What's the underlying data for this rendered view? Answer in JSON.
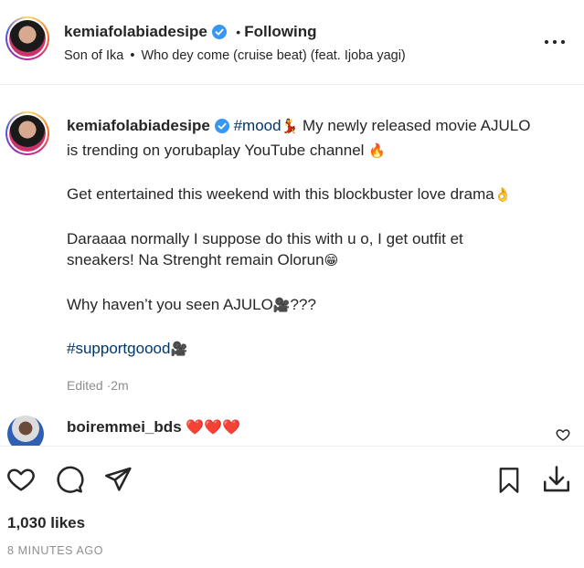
{
  "header": {
    "username": "kemiafolabiadesipe",
    "separator": "•",
    "follow_status": "Following",
    "audio": {
      "artist": "Son of Ika",
      "separator": "•",
      "track": "Who dey come (cruise beat) (feat. Ijoba yagi)"
    },
    "more_icon": "more-horizontal-icon"
  },
  "caption": {
    "username": "kemiafolabiadesipe",
    "line1_hashtag": "#mood",
    "line1_emoji": "💃",
    "line1_text": "My newly released movie AJULO",
    "line2_text": "is trending on yorubaplay YouTube channel",
    "line2_emoji": "🔥",
    "para2_text": "Get entertained this weekend with this blockbuster love drama",
    "para2_emoji": "👌",
    "para3_line1": "Daraaaa normally I suppose do this with u o, I get outfit et",
    "para3_line2": "sneakers! Na Strenght remain Olorun",
    "para3_emoji": "😁",
    "para4_text": "Why haven’t you seen AJULO",
    "para4_emoji": "🎥",
    "para4_suffix": "???",
    "hashtag2": "#supportgoood",
    "hashtag2_emoji": "🎥",
    "edited": "Edited",
    "dot": "·",
    "time": "2m"
  },
  "comment": {
    "username": "boiremmei_bds",
    "text": "❤️❤️❤️",
    "like_icon": "heart-outline-icon"
  },
  "actions": {
    "like_icon": "heart-icon",
    "comment_icon": "comment-icon",
    "share_icon": "send-icon",
    "save_icon": "bookmark-icon",
    "download_icon": "download-icon"
  },
  "likes": "1,030 likes",
  "timestamp": "8 MINUTES AGO",
  "colors": {
    "verified": "#3897f0",
    "hashtag": "#00376b",
    "muted": "#8e8e8e",
    "divider": "#efefef"
  }
}
